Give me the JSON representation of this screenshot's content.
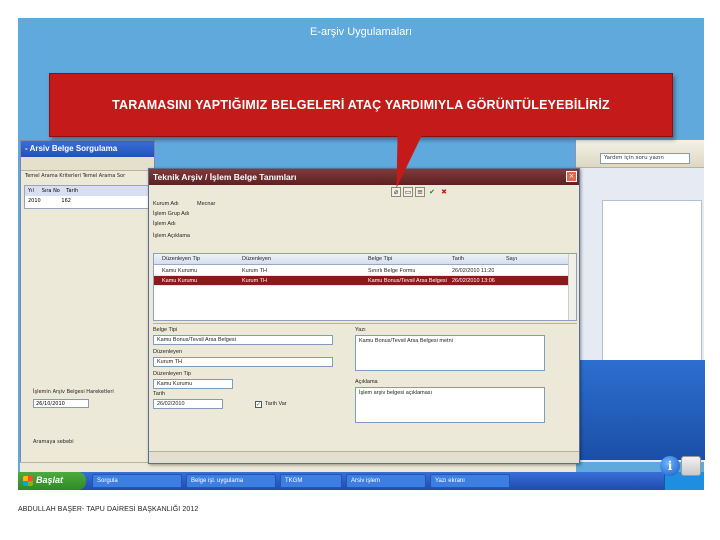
{
  "slide": {
    "title": "E-arşiv Uygulamaları",
    "callout": "TARAMASINI YAPTIĞIMIZ BELGELERİ ATAÇ YARDIMIYLA GÖRÜNTÜLEYEBİLİRİZ",
    "footer": "ABDULLAH BAŞER- TAPU DAİRESİ BAŞKANLIĞI 2012"
  },
  "bg_window": {
    "title": "- Arsiv Belge Sorgulama",
    "tabs": "Temel Arama Kriterleri   Temel Arama Sor",
    "grid_headers": [
      "Yıl",
      "Sıra No",
      "Tarih"
    ],
    "grid_row": [
      "2010",
      "162",
      ""
    ],
    "bottom_label": "İşlemin Arşiv Belgesi Hareketleri",
    "bottom_value": "26/10/2010",
    "status": "Aramaya sebebi"
  },
  "right_window": {
    "help_placeholder": "Yardım için soru yazın"
  },
  "dialog": {
    "title": "Teknik Arşiv / İşlem Belge Tanımları",
    "close": "×",
    "fields": [
      {
        "label": "Kurum Adı",
        "value": "Mecnar"
      },
      {
        "label": "İşlem Grup Adı",
        "value": ""
      },
      {
        "label": "İşlem Adı",
        "value": ""
      },
      {
        "label": "İşlem Açıklama",
        "value": ""
      }
    ],
    "grid": {
      "headers": [
        "Düzenleyen Tip",
        "Düzenleyen",
        "Belge Tipi",
        "Tarih",
        "Sayı"
      ],
      "rows": [
        [
          "Kamu Kurumu",
          "Kurum TH",
          "Sınırlı Belge Formu",
          "26/02/2010 11:20",
          ""
        ],
        [
          "Kamu Kurumu",
          "Kurum TH",
          "Kamu Bonus/Tevsil Arsa Belgesi",
          "26/02/2010 13:06",
          ""
        ]
      ]
    },
    "lower": {
      "belge_tipi_label": "Belge Tipi",
      "belge_tipi_value": "Kamu Bonus/Tevsil Arsa Belgesi",
      "duzenleyen_label": "Düzenleyen",
      "duzenleyen_value": "Kurum TH",
      "duzenleyen_tip_label": "Düzenleyen Tip",
      "duzenleyen_tip_value": "Kamu Kurumu",
      "tarih_label": "Tarih",
      "tarih_value": "26/02/2010",
      "checkbox_label": "Tarih Var",
      "aciklama_label": "Yazı",
      "aciklama_value": "Kamu Bonus/Tevsil Arsa Belgesi metni",
      "aciklama2_label": "Açıklama",
      "aciklama2_value": "İşlem arşiv belgesi açıklaması"
    }
  },
  "taskbar": {
    "start": "Başlat",
    "tasks": [
      "Sorgula",
      "Belge işl. uygulama",
      "TKGM",
      "Arsiv işlem",
      "Yazı ekranı"
    ]
  }
}
